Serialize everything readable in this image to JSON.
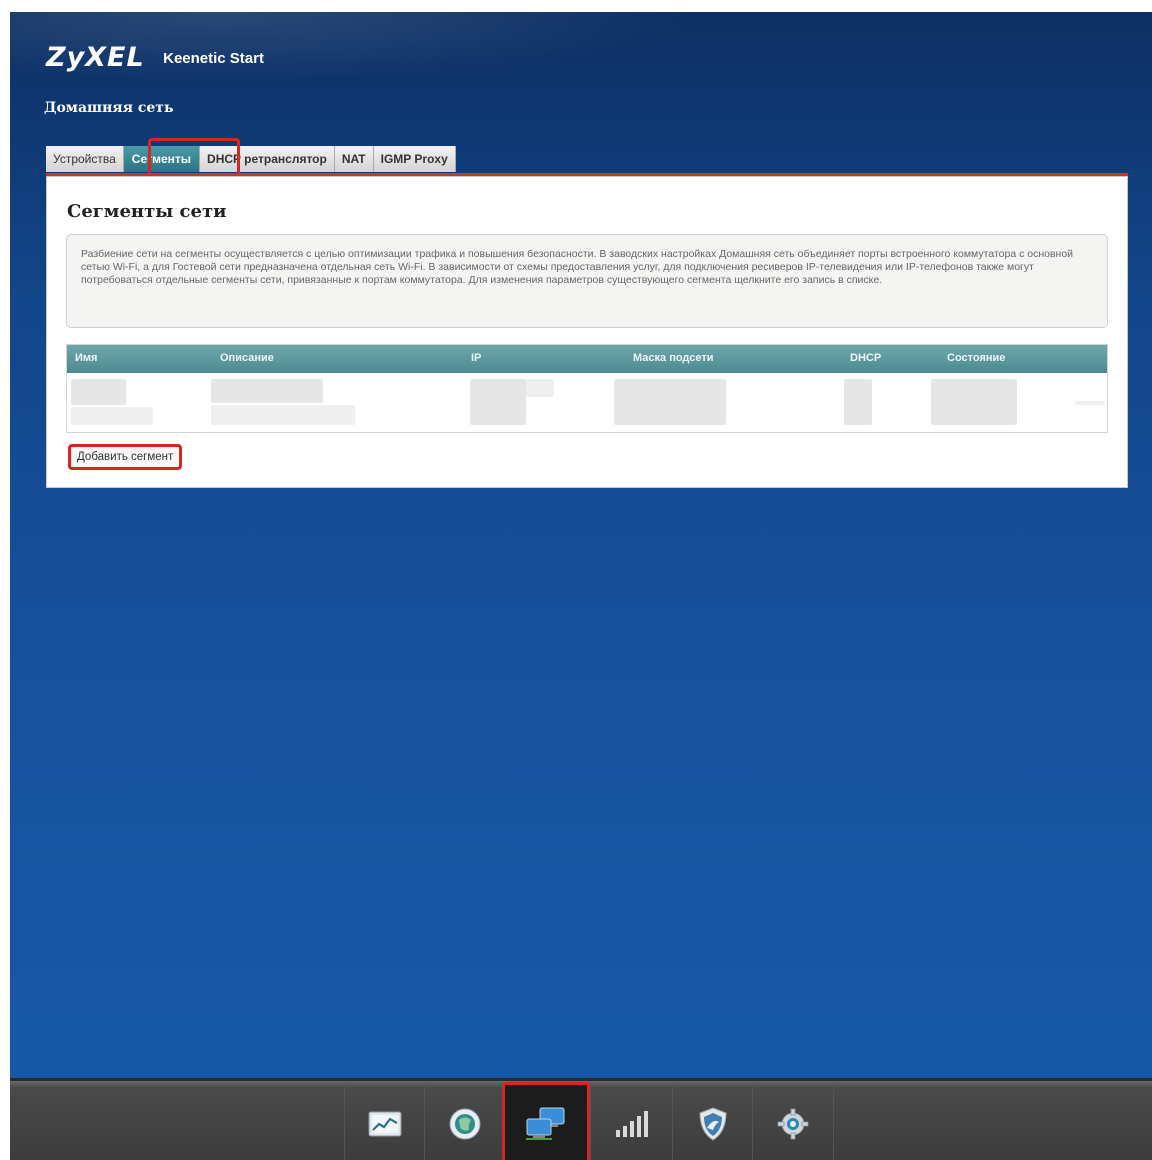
{
  "header": {
    "brand": "ZyXEL",
    "model": "Keenetic Start",
    "section_title": "Домашняя сеть"
  },
  "tabs": [
    {
      "label": "Устройства",
      "active": false
    },
    {
      "label": "Сегменты",
      "active": true
    },
    {
      "label": "DHCP ретранслятор",
      "active": false
    },
    {
      "label": "NAT",
      "active": false
    },
    {
      "label": "IGMP Proxy",
      "active": false
    }
  ],
  "panel": {
    "title": "Сегменты сети",
    "info": "Разбиение сети на сегменты осуществляется с целью оптимизации трафика и повышения безопасности. В заводских настройках Домашняя сеть объединяет порты встроенного коммутатора с основной сетью Wi-Fi, а для Гостевой сети предназначена отдельная сеть Wi-Fi. В зависимости от схемы предоставления услуг, для подключения ресиверов IP-телевидения или IP-телефонов также могут потребоваться отдельные сегменты сети, привязанные к портам коммутатора. Для изменения параметров существующего сегмента щелкните его запись в списке.",
    "table": {
      "columns": [
        "Имя",
        "Описание",
        "IP",
        "Маска подсети",
        "DHCP",
        "Состояние"
      ]
    },
    "add_button": "Добавить сегмент"
  },
  "dock": {
    "items": [
      "monitor-icon",
      "internet-globe-icon",
      "home-network-icon",
      "wifi-signal-icon",
      "security-shield-icon",
      "settings-gear-icon"
    ],
    "active": "home-network-icon"
  },
  "colors": {
    "highlight": "#d9261c",
    "tab_active": "#3d8b97",
    "table_header": "#5e9aa0",
    "background": "#17529e"
  }
}
